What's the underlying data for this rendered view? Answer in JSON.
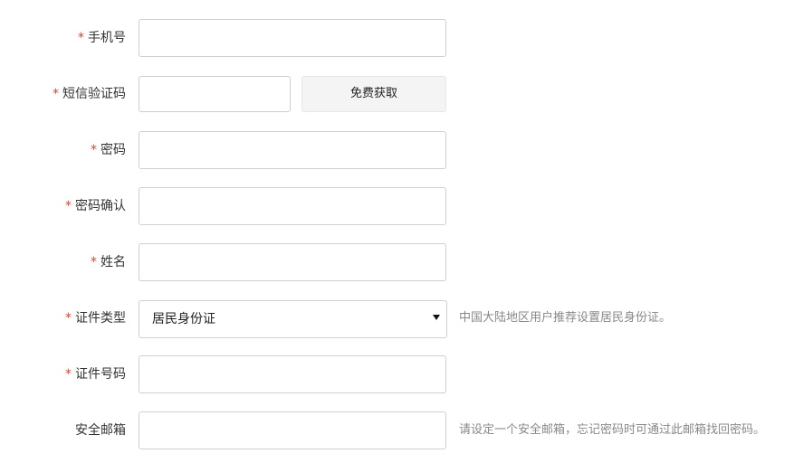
{
  "required_marker": "*",
  "fields": {
    "phone": {
      "label": "手机号",
      "value": ""
    },
    "sms_code": {
      "label": "短信验证码",
      "value": "",
      "button_label": "免费获取"
    },
    "password": {
      "label": "密码",
      "value": ""
    },
    "password_confirm": {
      "label": "密码确认",
      "value": ""
    },
    "name": {
      "label": "姓名",
      "value": ""
    },
    "id_type": {
      "label": "证件类型",
      "selected": "居民身份证",
      "hint": "中国大陆地区用户推荐设置居民身份证。"
    },
    "id_number": {
      "label": "证件号码",
      "value": ""
    },
    "email": {
      "label": "安全邮箱",
      "value": "",
      "hint": "请设定一个安全邮箱，忘记密码时可通过此邮箱找回密码。"
    }
  },
  "colors": {
    "required": "#e5412a",
    "hint": "#888888",
    "border": "#cfcfcf",
    "button_bg": "#f4f4f4"
  },
  "icons": {
    "select_caret": "chevron-down-icon"
  }
}
